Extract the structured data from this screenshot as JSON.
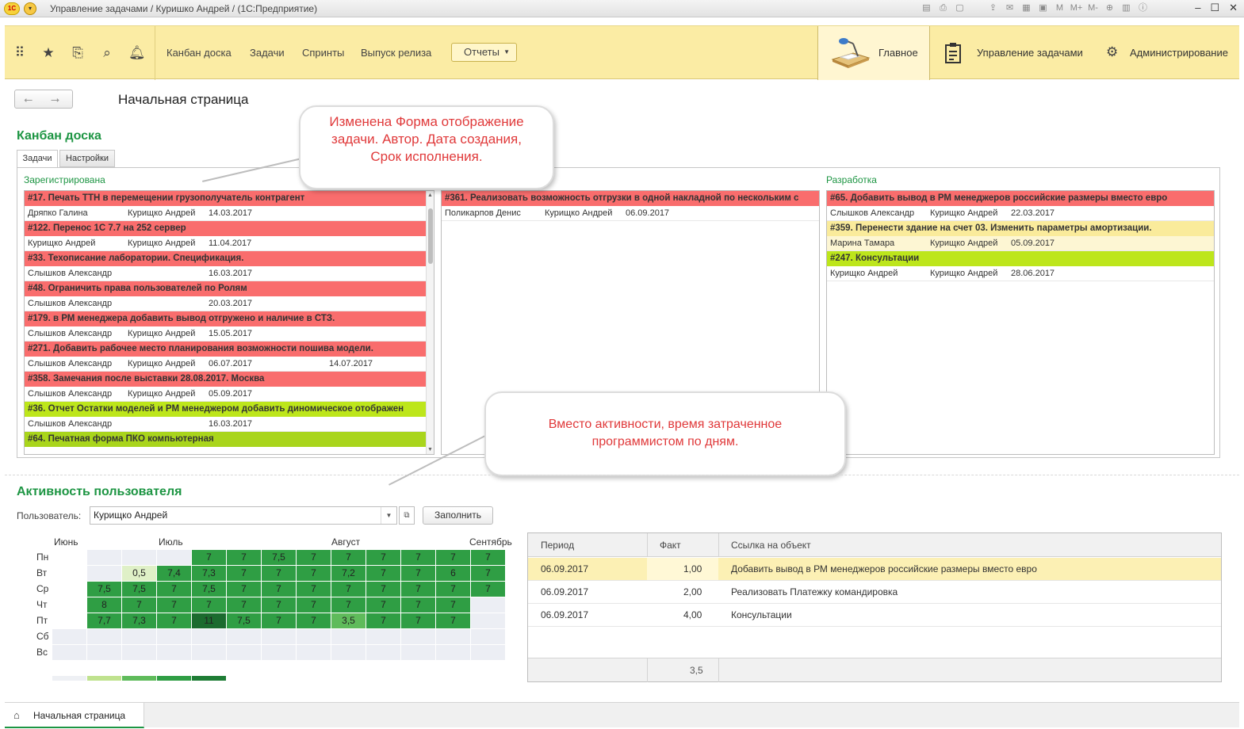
{
  "window": {
    "title": "Управление задачами / Куришко Андрей /  (1С:Предприятие)",
    "logo_text": "1С"
  },
  "nav": {
    "links": [
      "Канбан доска",
      "Задачи",
      "Спринты",
      "Выпуск релиза"
    ],
    "reports_label": "Отчеты",
    "sections": [
      "Главное",
      "Управление задачами",
      "Администрирование"
    ]
  },
  "page": {
    "title": "Начальная страница"
  },
  "kanban": {
    "heading": "Канбан доска",
    "tabs": [
      "Задачи",
      "Настройки"
    ],
    "columns": [
      {
        "title": "Зарегистрирована",
        "cards": [
          {
            "title": "#17. Печать ТТН в перемещении грузополучатель контрагент",
            "color": "#f96d6d",
            "author": "Дряпко Галина",
            "assignee": "Курищко Андрей",
            "created": "14.03.2017",
            "due": ""
          },
          {
            "title": "#122. Перенос 1С 7.7 на 252 сервер",
            "color": "#f96d6d",
            "author": "Курищко Андрей",
            "assignee": "Курищко Андрей",
            "created": "11.04.2017",
            "due": ""
          },
          {
            "title": "#33. Техописание лаборатории. Спецификация.",
            "color": "#f96d6d",
            "author": "Слышков Александр",
            "assignee": "",
            "created": "16.03.2017",
            "due": ""
          },
          {
            "title": "#48. Ограничить права пользователей по Ролям",
            "color": "#f96d6d",
            "author": "Слышков Александр",
            "assignee": "",
            "created": "20.03.2017",
            "due": ""
          },
          {
            "title": "#179. в РМ менеджера добавить вывод отгружено и наличие в СТЗ.",
            "color": "#f96d6d",
            "author": "Слышков Александр",
            "assignee": "Курищко Андрей",
            "created": "15.05.2017",
            "due": ""
          },
          {
            "title": "#271. Добавить рабочее место планирования возможности пошива модели.",
            "color": "#f96d6d",
            "author": "Слышков Александр",
            "assignee": "Курищко Андрей",
            "created": "06.07.2017",
            "due": "14.07.2017"
          },
          {
            "title": "#358. Замечания после выставки 28.08.2017. Москва",
            "color": "#f96d6d",
            "author": "Слышков Александр",
            "assignee": "Курищко Андрей",
            "created": "05.09.2017",
            "due": ""
          },
          {
            "title": "#36. Отчет Остатки моделей и РМ менеджером добавить диномическое отображен",
            "color": "#bde61b",
            "author": "Слышков Александр",
            "assignee": "",
            "created": "16.03.2017",
            "due": ""
          },
          {
            "title": "#64. Печатная форма ПКО компьютерная",
            "color": "#a9d51c",
            "author": "",
            "assignee": "",
            "created": "",
            "due": ""
          }
        ]
      },
      {
        "title": "",
        "cards": [
          {
            "title": "#361. Реализовать возможность отгрузки в одной накладной по нескольким с",
            "color": "#f96d6d",
            "author": "Поликарпов Денис",
            "assignee": "Курищко Андрей",
            "created": "06.09.2017",
            "due": ""
          }
        ]
      },
      {
        "title": "Разработка",
        "cards": [
          {
            "title": "#65. Добавить вывод в РМ менеджеров российские размеры вместо евро",
            "color": "#f96d6d",
            "author": "Слышков Александр",
            "assignee": "Курищко Андрей",
            "created": "22.03.2017",
            "due": ""
          },
          {
            "title": "#359. Перенести здание на счет 03. Изменить параметры амортизации.",
            "color": "#faeb9b",
            "author": "Марина Тамара",
            "assignee": "Курищко Андрей",
            "created": "05.09.2017",
            "due": ""
          },
          {
            "title": "#247. Консультации",
            "color": "#bde61b",
            "author": "Курищко Андрей",
            "assignee": "Курищко Андрей",
            "created": "28.06.2017",
            "due": ""
          }
        ]
      }
    ]
  },
  "callouts": {
    "form": "Изменена Форма отображение задачи. Автор. Дата создания, Срок исполнения.",
    "activity": "Вместо активности, время затраченное программистом по дням."
  },
  "activity": {
    "heading": "Активность пользователя",
    "user_label": "Пользователь:",
    "user_value": "Курищко Андрей",
    "fill_label": "Заполнить",
    "months": [
      "Июнь",
      "Июль",
      "Август",
      "Сентябрь"
    ],
    "days": [
      "Пн",
      "Вт",
      "Ср",
      "Чт",
      "Пт",
      "Сб",
      "Вс"
    ],
    "grid": [
      [
        "",
        "",
        "",
        "",
        "7",
        "7",
        "7,5",
        "7",
        "7",
        "7",
        "7",
        "7",
        "7"
      ],
      [
        "",
        "",
        "0,5",
        "7,4",
        "7,3",
        "7",
        "7",
        "7",
        "7,2",
        "7",
        "7",
        "6",
        "7"
      ],
      [
        "",
        "7,5",
        "7,5",
        "7",
        "7,5",
        "7",
        "7",
        "7",
        "7",
        "7",
        "7",
        "7",
        "7"
      ],
      [
        "",
        "8",
        "7",
        "7",
        "7",
        "7",
        "7",
        "7",
        "7",
        "7",
        "7",
        "7",
        ""
      ],
      [
        "",
        "7,7",
        "7,3",
        "7",
        "11",
        "7,5",
        "7",
        "7",
        "3,5",
        "7",
        "7",
        "7",
        ""
      ],
      [
        "",
        "",
        "",
        "",
        "",
        "",
        "",
        "",
        "",
        "",
        "",
        "",
        ""
      ],
      [
        "",
        "",
        "",
        "",
        "",
        "",
        "",
        "",
        "",
        "",
        "",
        "",
        ""
      ]
    ],
    "table": {
      "columns": [
        "Период",
        "Факт",
        "Ссылка на объект"
      ],
      "rows": [
        {
          "period": "06.09.2017",
          "fact": "1,00",
          "object": "Добавить вывод в РМ менеджеров российские размеры вместо евро"
        },
        {
          "period": "06.09.2017",
          "fact": "2,00",
          "object": "Реализовать Платежку командировка"
        },
        {
          "period": "06.09.2017",
          "fact": "4,00",
          "object": "Консультации"
        }
      ],
      "total": "3,5"
    }
  },
  "bottom": {
    "tab": "Начальная страница"
  }
}
